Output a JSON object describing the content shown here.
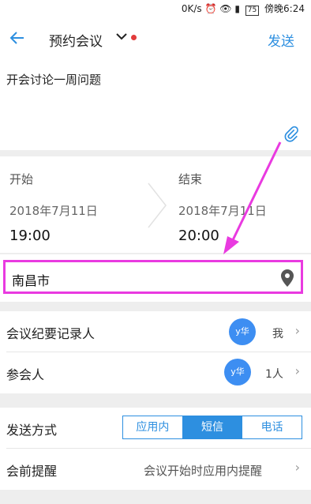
{
  "status_bar": {
    "speed": "0K/s",
    "battery": "75",
    "carrier_time": "傍晚6:24"
  },
  "header": {
    "title": "预约会议",
    "send_label": "发送"
  },
  "subject": "开会讨论一周问题",
  "schedule": {
    "start_label": "开始",
    "start_date": "2018年7月11日",
    "start_time": "19:00",
    "end_label": "结束",
    "end_date": "2018年7月11日",
    "end_time": "20:00"
  },
  "location": {
    "value": "南昌市"
  },
  "recorder": {
    "label": "会议纪要记录人",
    "avatar": "y华",
    "value": "我"
  },
  "participants": {
    "label": "参会人",
    "avatar": "y华",
    "count": "1人"
  },
  "send_method": {
    "label": "发送方式",
    "options": [
      "应用内",
      "短信",
      "电话"
    ],
    "selected": "短信"
  },
  "reminder": {
    "label": "会前提醒",
    "value": "会议开始时应用内提醒"
  },
  "colors": {
    "accent": "#2d8fe0",
    "highlight": "#e93ae0",
    "avatar": "#3d8ef2"
  }
}
